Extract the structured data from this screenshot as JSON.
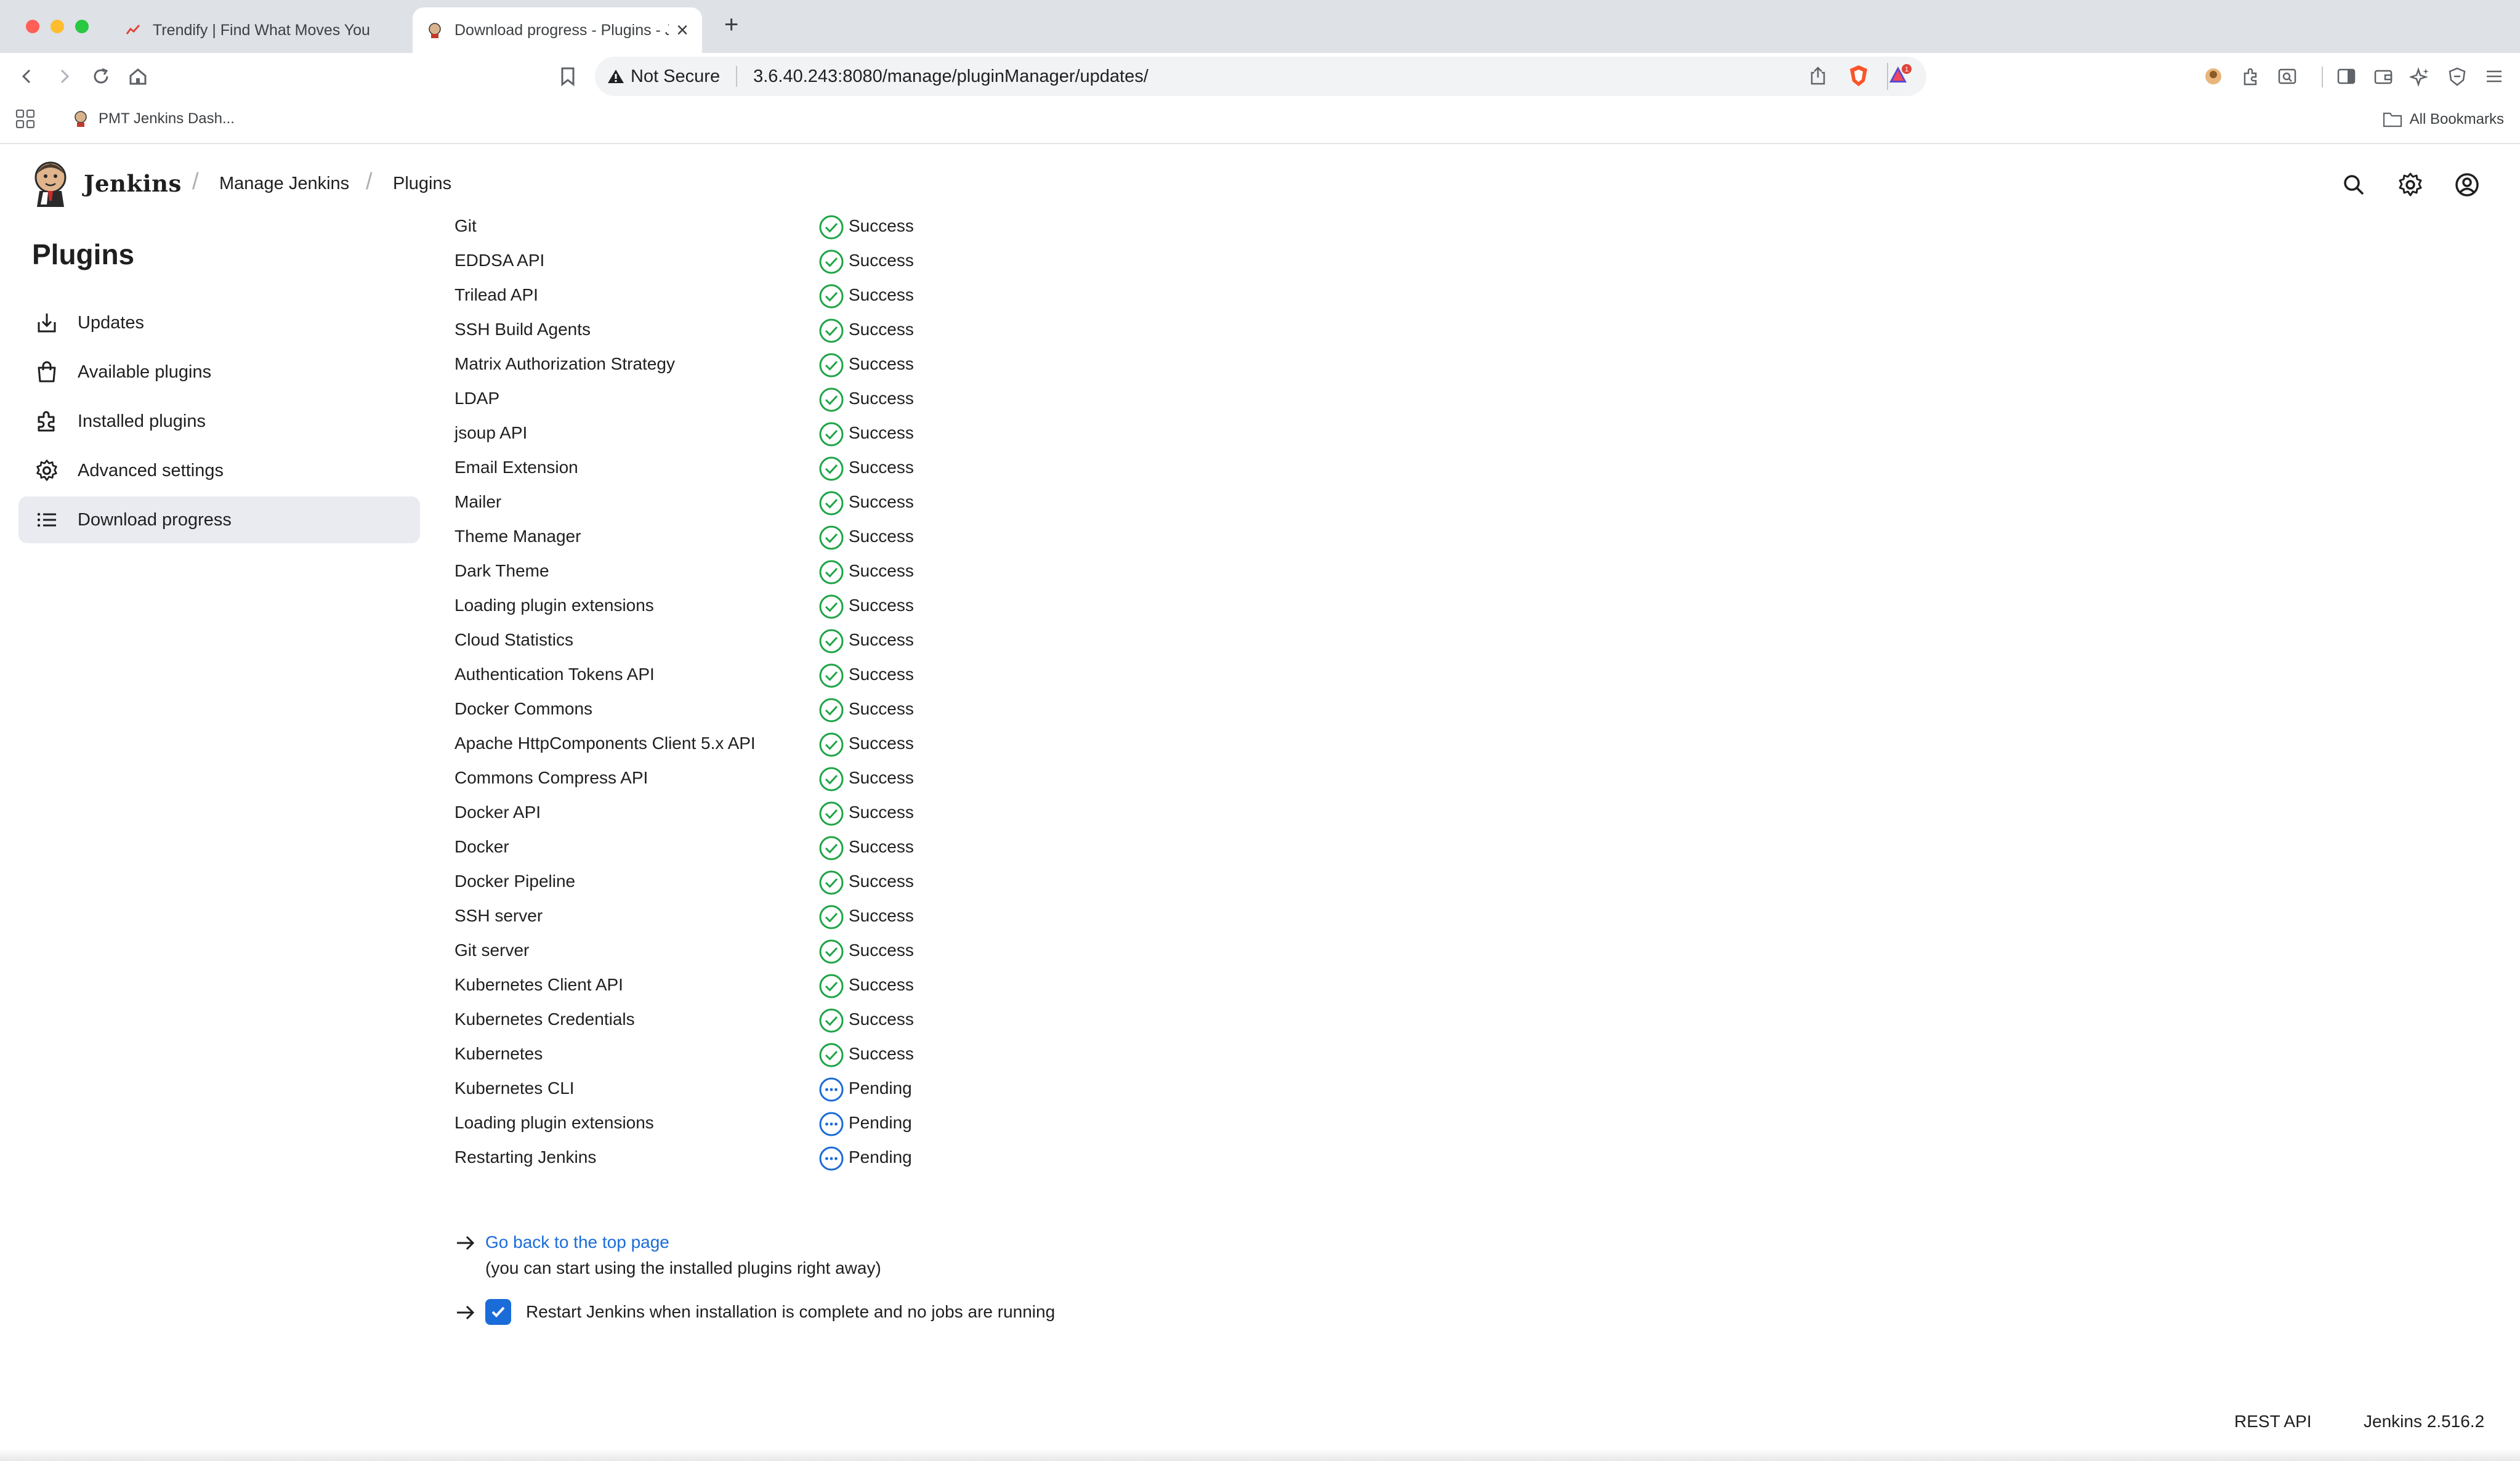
{
  "browser": {
    "tabs": [
      {
        "title": "Trendify | Find What Moves You",
        "active": false
      },
      {
        "title": "Download progress - Plugins - Jenkins",
        "active": true
      }
    ],
    "address": {
      "security_label": "Not Secure",
      "url": "3.6.40.243:8080/manage/pluginManager/updates/"
    },
    "bookmarks": {
      "items": [
        {
          "label": "PMT Jenkins Dash..."
        }
      ],
      "all_bookmarks": "All Bookmarks"
    },
    "brave_badge": "1",
    "colors": {
      "tabbar": "#dee1e6",
      "close": "#ff5f57",
      "minimize": "#febc2e",
      "zoom": "#28c840",
      "brave": "#fb542b"
    }
  },
  "header": {
    "brand": "Jenkins",
    "breadcrumbs": [
      "Manage Jenkins",
      "Plugins"
    ]
  },
  "sidebar": {
    "title": "Plugins",
    "items": [
      {
        "label": "Updates",
        "icon": "download-icon",
        "active": false
      },
      {
        "label": "Available plugins",
        "icon": "shopping-bag-icon",
        "active": false
      },
      {
        "label": "Installed plugins",
        "icon": "puzzle-icon",
        "active": false
      },
      {
        "label": "Advanced settings",
        "icon": "gear-icon",
        "active": false
      },
      {
        "label": "Download progress",
        "icon": "list-icon",
        "active": true
      }
    ]
  },
  "plugins": [
    {
      "name": "Git",
      "status": "Success"
    },
    {
      "name": "EDDSA API",
      "status": "Success"
    },
    {
      "name": "Trilead API",
      "status": "Success"
    },
    {
      "name": "SSH Build Agents",
      "status": "Success"
    },
    {
      "name": "Matrix Authorization Strategy",
      "status": "Success"
    },
    {
      "name": "LDAP",
      "status": "Success"
    },
    {
      "name": "jsoup API",
      "status": "Success"
    },
    {
      "name": "Email Extension",
      "status": "Success"
    },
    {
      "name": "Mailer",
      "status": "Success"
    },
    {
      "name": "Theme Manager",
      "status": "Success"
    },
    {
      "name": "Dark Theme",
      "status": "Success"
    },
    {
      "name": "Loading plugin extensions",
      "status": "Success"
    },
    {
      "name": "Cloud Statistics",
      "status": "Success"
    },
    {
      "name": "Authentication Tokens API",
      "status": "Success"
    },
    {
      "name": "Docker Commons",
      "status": "Success"
    },
    {
      "name": "Apache HttpComponents Client 5.x API",
      "status": "Success"
    },
    {
      "name": "Commons Compress API",
      "status": "Success"
    },
    {
      "name": "Docker API",
      "status": "Success"
    },
    {
      "name": "Docker",
      "status": "Success"
    },
    {
      "name": "Docker Pipeline",
      "status": "Success"
    },
    {
      "name": "SSH server",
      "status": "Success"
    },
    {
      "name": "Git server",
      "status": "Success"
    },
    {
      "name": "Kubernetes Client API",
      "status": "Success"
    },
    {
      "name": "Kubernetes Credentials",
      "status": "Success"
    },
    {
      "name": "Kubernetes",
      "status": "Success"
    },
    {
      "name": "Kubernetes CLI",
      "status": "Pending"
    },
    {
      "name": "Loading plugin extensions",
      "status": "Pending"
    },
    {
      "name": "Restarting Jenkins",
      "status": "Pending"
    }
  ],
  "status_colors": {
    "Success": "#1ea446",
    "Pending": "#1a6cd8"
  },
  "actions": {
    "back_link": "Go back to the top page",
    "back_note": "(you can start using the installed plugins right away)",
    "restart_label": "Restart Jenkins when installation is complete and no jobs are running",
    "restart_checked": true
  },
  "footer": {
    "rest_api": "REST API",
    "version": "Jenkins 2.516.2"
  }
}
